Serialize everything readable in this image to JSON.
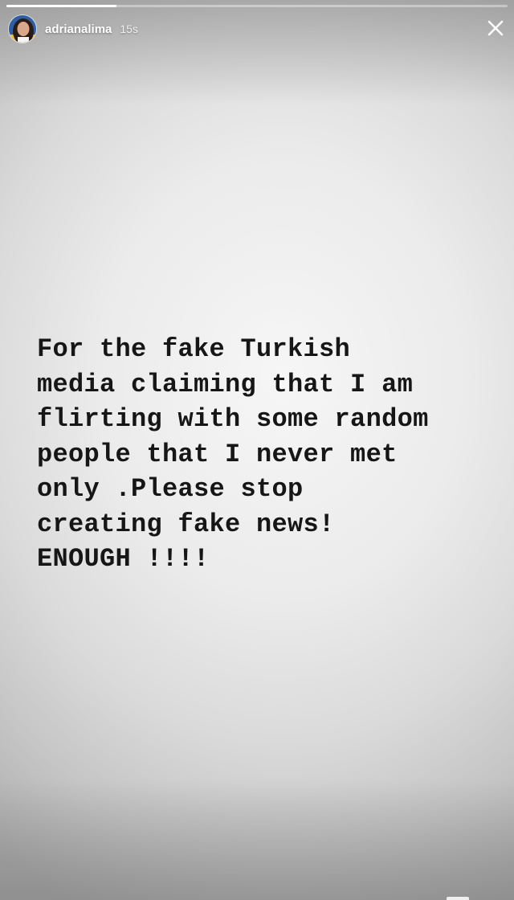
{
  "story": {
    "progress": 0.22,
    "username": "adrianalima",
    "timestamp": "15s",
    "text": "For the fake Turkish\nmedia claiming that I am\nflirting with some random\npeople that I never met\nonly .Please stop\ncreating fake news!\nENOUGH !!!!"
  },
  "icons": {
    "avatar": "profile-photo",
    "close": "close-icon"
  },
  "colors": {
    "text": "#161616",
    "progress_fill": "#ffffff"
  }
}
